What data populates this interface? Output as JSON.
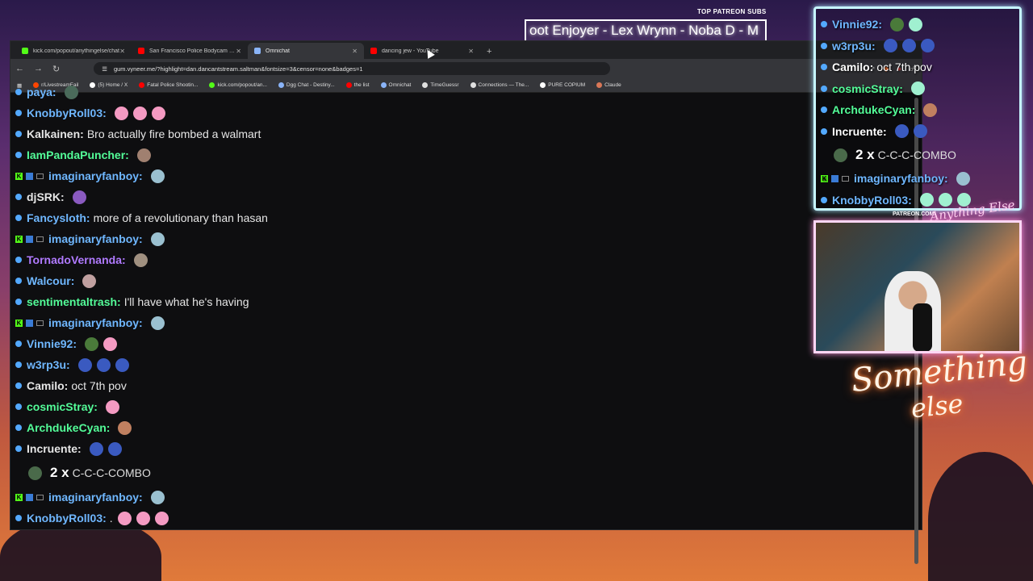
{
  "stream_overlay": {
    "patreon_label": "TOP PATREON SUBS",
    "patreon_marquee": "oot Enjoyer - Lex Wrynn -  Noba D - M",
    "patreon_url": "PATREON.COM/",
    "logo_text": "Anything Else",
    "neon_line1": "Something",
    "neon_line2": "else"
  },
  "tabs": [
    {
      "label": "kick.com/popout/anythingelse/chat",
      "color": "#53fc18",
      "active": false
    },
    {
      "label": "San Francisco Police Bodycam Video",
      "color": "#ff0000",
      "active": false
    },
    {
      "label": "Omnichat",
      "color": "#8ab4f8",
      "active": true
    },
    {
      "label": "dancing jew - YouTube",
      "color": "#ff0000",
      "active": false
    }
  ],
  "address_bar": {
    "url": "gum.vyneer.me/?highlight=dan.dancantstream.saltman&fontsize=3&censor=none&badges=1"
  },
  "bookmarks": [
    {
      "label": "r/LivestreamFail",
      "color": "#ff4500"
    },
    {
      "label": "(5) Home / X",
      "color": "#ffffff"
    },
    {
      "label": "Fatal Police Shootin...",
      "color": "#ff0000"
    },
    {
      "label": "kick.com/popout/an...",
      "color": "#53fc18"
    },
    {
      "label": "Dgg Chat - Destiny...",
      "color": "#8ab4f8"
    },
    {
      "label": "the list",
      "color": "#ff0000"
    },
    {
      "label": "Omnichat",
      "color": "#8ab4f8"
    },
    {
      "label": "TimeGuessr",
      "color": "#e0e0e0"
    },
    {
      "label": "Connections — The...",
      "color": "#e0e0e0"
    },
    {
      "label": "PURE COPIUM",
      "color": "#ffffff"
    },
    {
      "label": "Claude",
      "color": "#d97757"
    }
  ],
  "chat": [
    {
      "user": "paya",
      "color": "#6fb7ff",
      "text": "",
      "platform": "twitch",
      "emotes": [
        "#4a6a5a"
      ]
    },
    {
      "user": "KnobbyRoll03",
      "color": "#6fb7ff",
      "text": "",
      "platform": "twitch",
      "emotes": [
        "#f49ac2",
        "#f49ac2",
        "#f49ac2"
      ]
    },
    {
      "user": "Kalkainen",
      "color": "#e6e6e6",
      "text": "Bro actually fire bombed a walmart",
      "platform": "twitch",
      "emotes": []
    },
    {
      "user": "IamPandaPuncher",
      "color": "#53fc98",
      "text": "",
      "platform": "twitch",
      "emotes": [
        "#a08070"
      ]
    },
    {
      "user": "imaginaryfanboy",
      "color": "#6fb7ff",
      "text": "",
      "platform": "kick",
      "emotes": [
        "#9ac0d0"
      ]
    },
    {
      "user": "djSRK",
      "color": "#e6e6e6",
      "text": "",
      "platform": "twitch",
      "emotes": [
        "#8a5ac0"
      ]
    },
    {
      "user": "Fancysloth",
      "color": "#6fb7ff",
      "text": "more of a revolutionary than hasan",
      "platform": "twitch",
      "emotes": []
    },
    {
      "user": "imaginaryfanboy",
      "color": "#6fb7ff",
      "text": "",
      "platform": "kick",
      "emotes": [
        "#9ac0d0"
      ]
    },
    {
      "user": "TornadoVernanda",
      "color": "#b07aff",
      "text": "",
      "platform": "twitch",
      "emotes": [
        "#a09080"
      ]
    },
    {
      "user": "Walcour",
      "color": "#6fb7ff",
      "text": "",
      "platform": "twitch",
      "emotes": [
        "#c0a0a0"
      ]
    },
    {
      "user": "sentimentaltrash",
      "color": "#53fc98",
      "text": "I'll have what he's having",
      "platform": "twitch",
      "emotes": []
    },
    {
      "user": "imaginaryfanboy",
      "color": "#6fb7ff",
      "text": "",
      "platform": "kick",
      "emotes": [
        "#9ac0d0"
      ]
    },
    {
      "user": "Vinnie92",
      "color": "#6fb7ff",
      "text": "",
      "platform": "twitch",
      "emotes": [
        "#4a7a3a",
        "#f49ac2"
      ]
    },
    {
      "user": "w3rp3u",
      "color": "#6fb7ff",
      "text": "",
      "platform": "twitch",
      "emotes": [
        "#3a5ac0",
        "#3a5ac0",
        "#3a5ac0"
      ]
    },
    {
      "user": "Camilo",
      "color": "#e6e6e6",
      "text": "oct 7th pov",
      "platform": "twitch",
      "emotes": []
    },
    {
      "user": "cosmicStray",
      "color": "#53fc98",
      "text": "",
      "platform": "twitch",
      "emotes": [
        "#f49ac2"
      ]
    },
    {
      "user": "ArchdukeCyan",
      "color": "#53fc98",
      "text": "",
      "platform": "twitch",
      "emotes": [
        "#c08060"
      ]
    },
    {
      "user": "Incruente",
      "color": "#e6e6e6",
      "text": "",
      "platform": "twitch",
      "emotes": [
        "#3a5ac0",
        "#3a5ac0"
      ]
    }
  ],
  "combo": {
    "count": "2 x",
    "label": "C-C-C-COMBO"
  },
  "chat_after_combo": [
    {
      "user": "imaginaryfanboy",
      "color": "#6fb7ff",
      "text": "",
      "platform": "kick",
      "emotes": [
        "#9ac0d0"
      ]
    },
    {
      "user": "KnobbyRoll03",
      "color": "#6fb7ff",
      "text": ".",
      "platform": "twitch",
      "emotes": [
        "#f49ac2",
        "#f49ac2",
        "#f49ac2"
      ]
    }
  ],
  "overlay_chat": [
    {
      "user": "Vinnie92",
      "color": "#6fb7ff",
      "text": "",
      "platform": "twitch",
      "emotes": [
        "#4a7a3a",
        "#a0f0d0"
      ]
    },
    {
      "user": "w3rp3u",
      "color": "#6fb7ff",
      "text": "",
      "platform": "twitch",
      "emotes": [
        "#3a5ac0",
        "#3a5ac0",
        "#3a5ac0"
      ]
    },
    {
      "user": "Camilo",
      "color": "#ffffff",
      "text": "oct 7th pov",
      "platform": "twitch",
      "emotes": []
    },
    {
      "user": "cosmicStray",
      "color": "#53fc98",
      "text": "",
      "platform": "twitch",
      "emotes": [
        "#a0f0d0"
      ]
    },
    {
      "user": "ArchdukeCyan",
      "color": "#53fc98",
      "text": "",
      "platform": "twitch",
      "emotes": [
        "#c08060"
      ]
    },
    {
      "user": "Incruente",
      "color": "#ffffff",
      "text": "",
      "platform": "twitch",
      "emotes": [
        "#3a5ac0",
        "#3a5ac0"
      ]
    }
  ],
  "overlay_combo": {
    "count": "2 x",
    "label": "C-C-C-COMBO"
  },
  "overlay_chat_after": [
    {
      "user": "imaginaryfanboy",
      "color": "#6fb7ff",
      "text": "",
      "platform": "kick",
      "emotes": [
        "#9ac0d0"
      ]
    },
    {
      "user": "KnobbyRoll03",
      "color": "#6fb7ff",
      "text": "",
      "platform": "twitch",
      "emotes": [
        "#a0f0d0",
        "#a0f0d0",
        "#a0f0d0"
      ]
    }
  ]
}
